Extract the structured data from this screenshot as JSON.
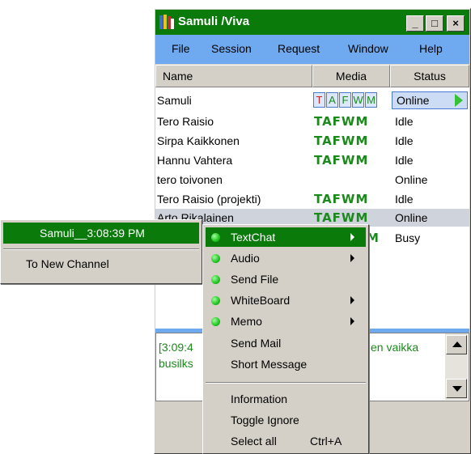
{
  "window": {
    "title": "Samuli /Viva",
    "title_icon": "app-book-icon",
    "controls": {
      "minimize": "_",
      "maximize": "□",
      "close": "×"
    },
    "title_color": "#0a7a0a",
    "menubar_color": "#6faaf0"
  },
  "menubar": [
    {
      "label": "File"
    },
    {
      "label": "Session"
    },
    {
      "label": "Request"
    },
    {
      "label": "Window"
    },
    {
      "label": "Help"
    }
  ],
  "list": {
    "headers": {
      "name": "Name",
      "media": "Media",
      "status": "Status"
    },
    "self": {
      "name": "Samuli",
      "media_letters": [
        "T",
        "A",
        "F",
        "W",
        "M"
      ],
      "status": "Online",
      "status_icon": "play-arrow-icon"
    },
    "rows": [
      {
        "name": "Tero Raisio",
        "media": "TAFWM",
        "status": "Idle"
      },
      {
        "name": "Sirpa Kaikkonen",
        "media": "TAFWM",
        "status": "Idle"
      },
      {
        "name": "Hannu Vahtera",
        "media": "TAFWM",
        "status": "Idle"
      },
      {
        "name": "tero toivonen",
        "media": "",
        "status": "Online"
      },
      {
        "name": "Tero Raisio (projekti)",
        "media": "TAFWM",
        "status": "Idle"
      },
      {
        "name": "Arto Rikalainen",
        "media": "TAFWM",
        "status": "Online"
      },
      {
        "name": "",
        "media": "M",
        "status": "Busy"
      }
    ]
  },
  "chat": {
    "line1_left": "[3:09:4",
    "line1_right": "en vaikka",
    "line2_left": "busilks"
  },
  "channel_menu": {
    "items": [
      {
        "label": "Samuli__3:08:39 PM",
        "selected": true
      },
      {
        "label": "To New Channel",
        "selected": false
      }
    ]
  },
  "context_menu": {
    "items": [
      {
        "label": "TextChat",
        "dot": true,
        "submenu": true,
        "selected": true
      },
      {
        "label": "Audio",
        "dot": true,
        "submenu": true
      },
      {
        "label": "Send File",
        "dot": true,
        "submenu": false
      },
      {
        "label": "WhiteBoard",
        "dot": true,
        "submenu": true
      },
      {
        "label": "Memo",
        "dot": true,
        "submenu": true
      },
      {
        "label": "Send Mail",
        "dot": false
      },
      {
        "label": "Short Message",
        "dot": false
      },
      {
        "label": "Information",
        "dot": false
      },
      {
        "label": "Toggle Ignore",
        "dot": false
      },
      {
        "label": "Select all",
        "dot": false,
        "shortcut": "Ctrl+A"
      }
    ]
  }
}
